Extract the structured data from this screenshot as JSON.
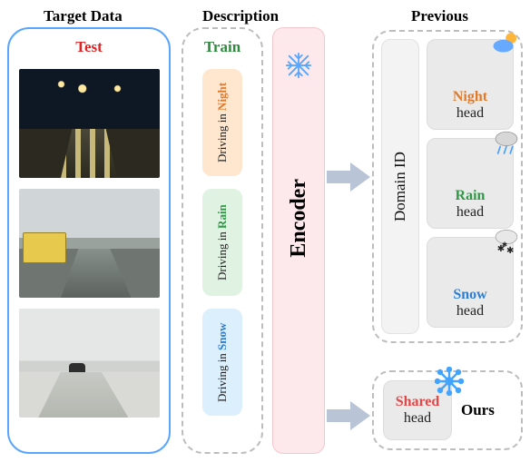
{
  "headers": {
    "target": "Target Data",
    "description": "Description",
    "previous": "Previous"
  },
  "target": {
    "test_label": "Test",
    "images": [
      {
        "domain": "night",
        "alt": "Night driving street scene"
      },
      {
        "domain": "rain",
        "alt": "Rainy driving street scene"
      },
      {
        "domain": "snow",
        "alt": "Snowy driving street scene"
      }
    ]
  },
  "description": {
    "train_label": "Train",
    "chips": [
      {
        "domain": "night",
        "lead": "Driving in ",
        "word": "Night"
      },
      {
        "domain": "rain",
        "lead": "Driving in ",
        "word": "Rain"
      },
      {
        "domain": "snow",
        "lead": "Driving in ",
        "word": "Snow"
      }
    ]
  },
  "encoder": {
    "label": "Encoder",
    "frozen_icon": "snowflake-icon"
  },
  "previous": {
    "domain_id_label": "Domain ID",
    "heads": [
      {
        "domain": "night",
        "label": "Night",
        "sub": "head",
        "icon": "sun-cloud-icon"
      },
      {
        "domain": "rain",
        "label": "Rain",
        "sub": "head",
        "icon": "rain-cloud-icon"
      },
      {
        "domain": "snow",
        "label": "Snow",
        "sub": "head",
        "icon": "snow-cloud-icon"
      }
    ]
  },
  "ours": {
    "label": "Ours",
    "shared": {
      "label": "Shared",
      "sub": "head",
      "icon": "snowflake-color-icon"
    }
  }
}
